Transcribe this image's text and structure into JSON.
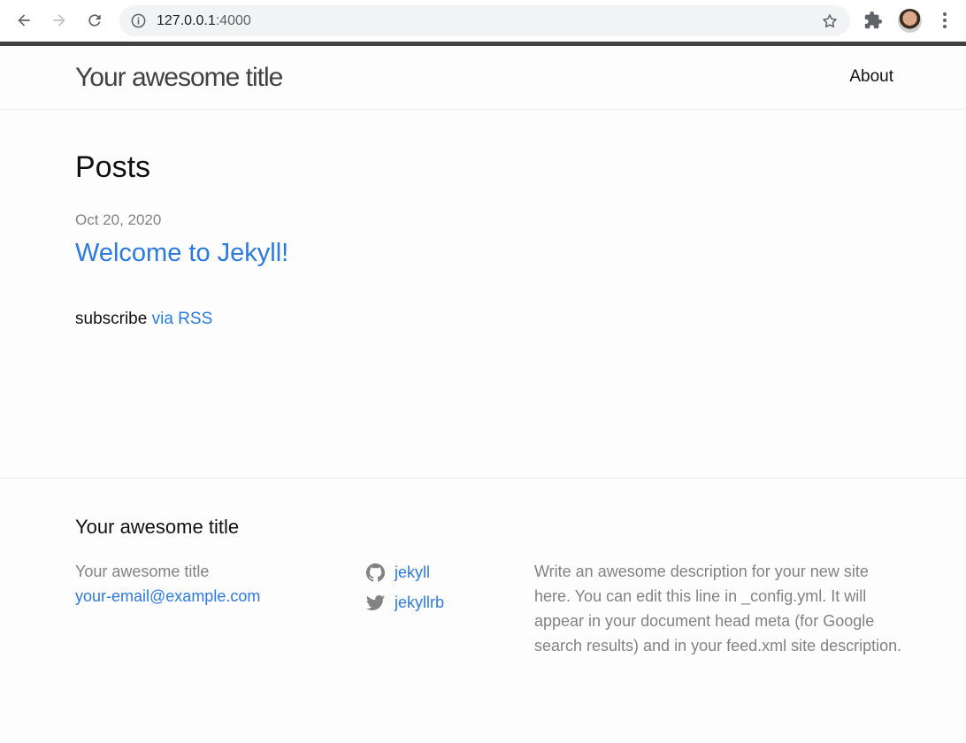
{
  "browser": {
    "url_host": "127.0.0.1",
    "url_port": ":4000"
  },
  "header": {
    "site_title": "Your awesome title",
    "nav": [
      {
        "label": "About"
      }
    ]
  },
  "main": {
    "heading": "Posts",
    "posts": [
      {
        "date": "Oct 20, 2020",
        "title": "Welcome to Jekyll!"
      }
    ],
    "subscribe_text": "subscribe",
    "subscribe_link": "via RSS"
  },
  "footer": {
    "heading": "Your awesome title",
    "name": "Your awesome title",
    "email": "your-email@example.com",
    "social": [
      {
        "icon": "github-icon",
        "label": "jekyll"
      },
      {
        "icon": "twitter-icon",
        "label": "jekyllrb"
      }
    ],
    "description": "Write an awesome description for your new site here. You can edit this line in _config.yml. It will appear in your document head meta (for Google search results) and in your feed.xml site description."
  },
  "colors": {
    "link": "#2a7ae2",
    "muted_text": "#828282",
    "chrome_separator": "#424242"
  }
}
